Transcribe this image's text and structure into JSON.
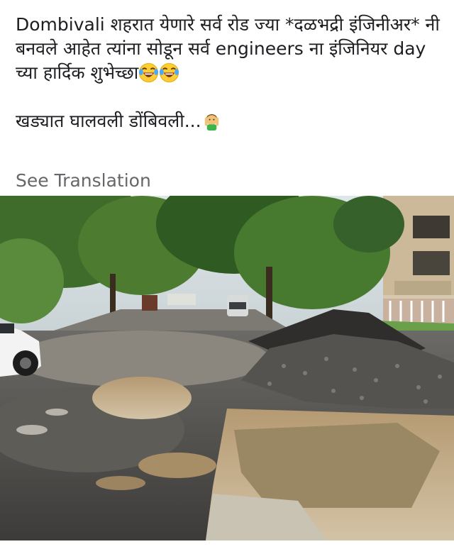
{
  "post": {
    "line1": "Dombivali शहरात येणारे सर्व रोड ज्या *दळभद्री इंजिनीअर* नी बनवले आहेत त्यांना सोडून सर्व engineers ना इंजिनियर day च्या हार्दिक शुभेच्छा",
    "line2": "खड्यात घालवली डोंबिवली...",
    "emojis": [
      "laughing-tears-emoji",
      "laughing-tears-emoji",
      "person-facepalm-emoji"
    ]
  },
  "see_translation_label": "See Translation",
  "photo": {
    "subject": "potholed-road-photo"
  }
}
